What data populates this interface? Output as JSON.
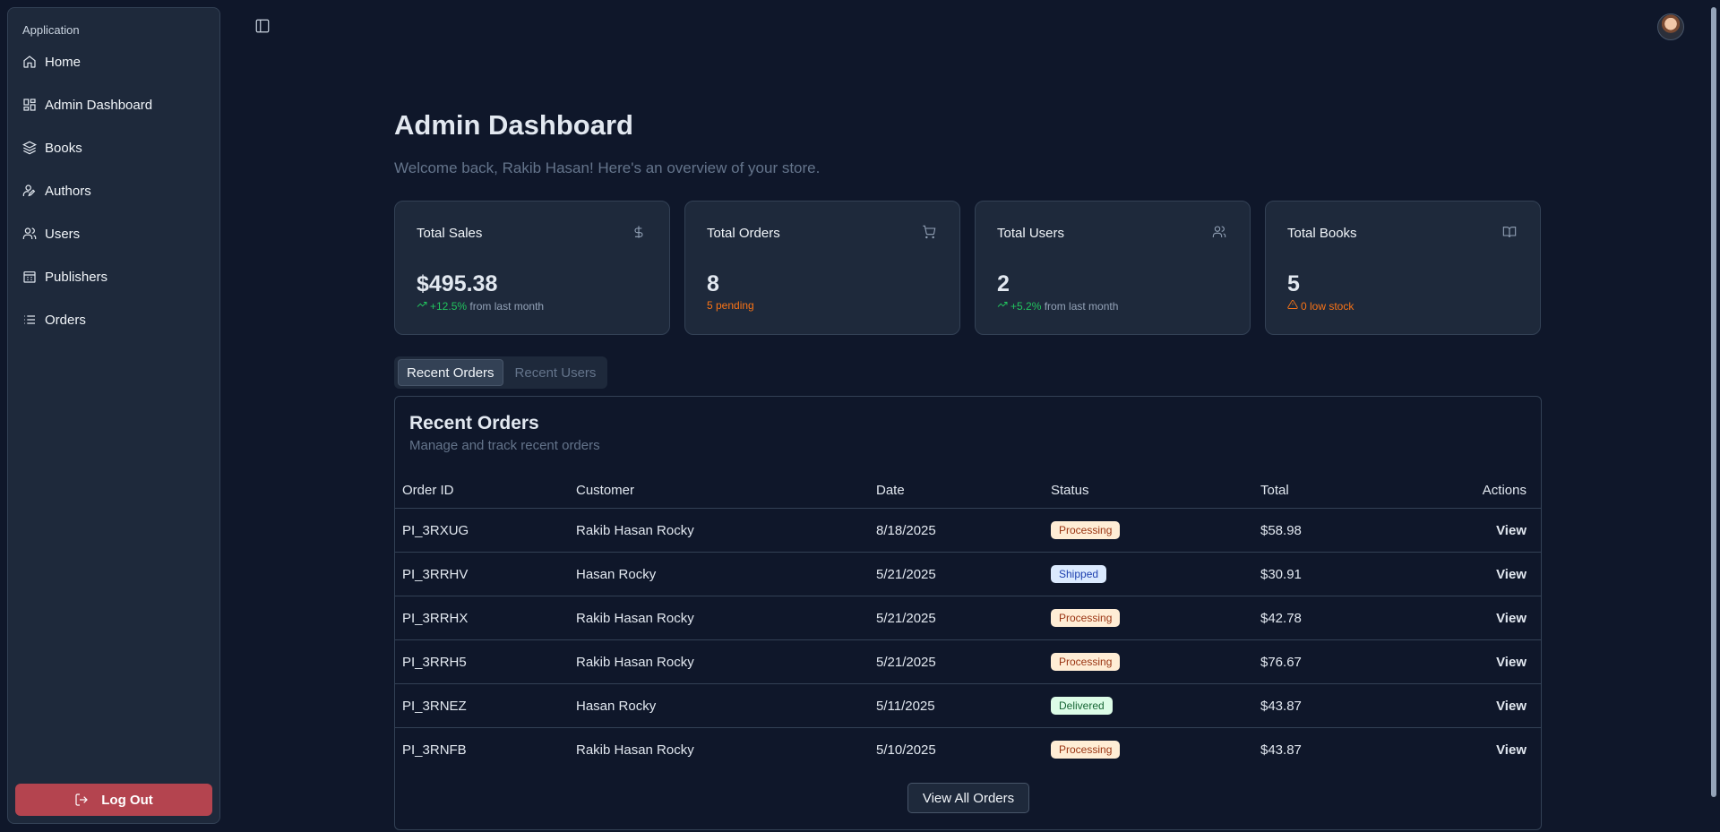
{
  "sidebar": {
    "group_label": "Application",
    "items": [
      {
        "label": "Home",
        "icon": "home-icon"
      },
      {
        "label": "Admin Dashboard",
        "icon": "dashboard-icon"
      },
      {
        "label": "Books",
        "icon": "layers-icon"
      },
      {
        "label": "Authors",
        "icon": "user-pen-icon"
      },
      {
        "label": "Users",
        "icon": "users-icon"
      },
      {
        "label": "Publishers",
        "icon": "building-icon"
      },
      {
        "label": "Orders",
        "icon": "list-icon"
      }
    ],
    "logout_label": "Log Out"
  },
  "header": {
    "title": "Admin Dashboard",
    "subtitle": "Welcome back, Rakib Hasan! Here's an overview of your store."
  },
  "cards": [
    {
      "title": "Total Sales",
      "value": "$495.38",
      "note_highlight": "+12.5%",
      "note_rest": "from last month",
      "icon": "dollar-icon"
    },
    {
      "title": "Total Orders",
      "value": "8",
      "note_highlight": "5 pending",
      "note_rest": "",
      "icon": "cart-icon"
    },
    {
      "title": "Total Users",
      "value": "2",
      "note_highlight": "+5.2%",
      "note_rest": "from last month",
      "icon": "users-icon"
    },
    {
      "title": "Total Books",
      "value": "5",
      "note_highlight": "0 low stock",
      "note_rest": "",
      "icon": "book-open-icon"
    }
  ],
  "tabs": [
    {
      "label": "Recent Orders",
      "active": true
    },
    {
      "label": "Recent Users",
      "active": false
    }
  ],
  "orders": {
    "title": "Recent Orders",
    "description": "Manage and track recent orders",
    "columns": [
      "Order ID",
      "Customer",
      "Date",
      "Status",
      "Total",
      "Actions"
    ],
    "rows": [
      {
        "id": "PI_3RXUG",
        "customer": "Rakib Hasan Rocky",
        "date": "8/18/2025",
        "status": "Processing",
        "total": "$58.98",
        "action": "View"
      },
      {
        "id": "PI_3RRHV",
        "customer": "Hasan Rocky",
        "date": "5/21/2025",
        "status": "Shipped",
        "total": "$30.91",
        "action": "View"
      },
      {
        "id": "PI_3RRHX",
        "customer": "Rakib Hasan Rocky",
        "date": "5/21/2025",
        "status": "Processing",
        "total": "$42.78",
        "action": "View"
      },
      {
        "id": "PI_3RRH5",
        "customer": "Rakib Hasan Rocky",
        "date": "5/21/2025",
        "status": "Processing",
        "total": "$76.67",
        "action": "View"
      },
      {
        "id": "PI_3RNEZ",
        "customer": "Hasan Rocky",
        "date": "5/11/2025",
        "status": "Delivered",
        "total": "$43.87",
        "action": "View"
      },
      {
        "id": "PI_3RNFB",
        "customer": "Rakib Hasan Rocky",
        "date": "5/10/2025",
        "status": "Processing",
        "total": "$43.87",
        "action": "View"
      }
    ],
    "view_all_label": "View All Orders"
  },
  "colors": {
    "background": "#0f172a",
    "card": "#1e293b",
    "logout": "#b4444f",
    "positive": "#22c55e",
    "warning": "#f97316"
  }
}
